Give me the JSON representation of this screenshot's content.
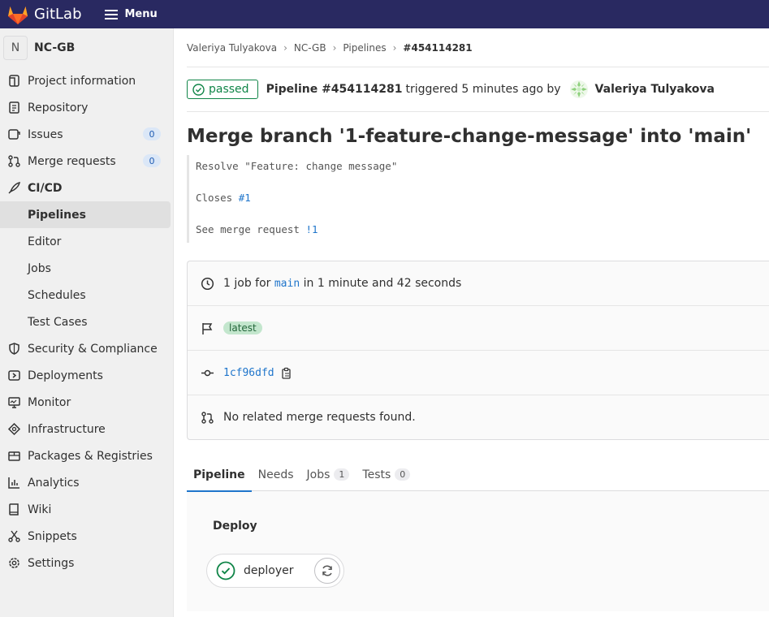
{
  "topbar": {
    "brand": "GitLab",
    "menu_label": "Menu"
  },
  "project": {
    "avatar_letter": "N",
    "name": "NC-GB"
  },
  "sidebar": {
    "items": [
      {
        "label": "Project information",
        "icon": "project-info-icon"
      },
      {
        "label": "Repository",
        "icon": "repository-icon"
      },
      {
        "label": "Issues",
        "icon": "issues-icon",
        "count": "0"
      },
      {
        "label": "Merge requests",
        "icon": "merge-request-icon",
        "count": "0"
      },
      {
        "label": "CI/CD",
        "icon": "rocket-icon"
      },
      {
        "label": "Pipelines"
      },
      {
        "label": "Editor"
      },
      {
        "label": "Jobs"
      },
      {
        "label": "Schedules"
      },
      {
        "label": "Test Cases"
      },
      {
        "label": "Security & Compliance",
        "icon": "shield-icon"
      },
      {
        "label": "Deployments",
        "icon": "deployments-icon"
      },
      {
        "label": "Monitor",
        "icon": "monitor-icon"
      },
      {
        "label": "Infrastructure",
        "icon": "infrastructure-icon"
      },
      {
        "label": "Packages & Registries",
        "icon": "package-icon"
      },
      {
        "label": "Analytics",
        "icon": "analytics-icon"
      },
      {
        "label": "Wiki",
        "icon": "wiki-icon"
      },
      {
        "label": "Snippets",
        "icon": "snippets-icon"
      },
      {
        "label": "Settings",
        "icon": "settings-icon"
      }
    ]
  },
  "breadcrumb": {
    "user": "Valeriya Tulyakova",
    "project": "NC-GB",
    "section": "Pipelines",
    "current": "#454114281"
  },
  "pipeline": {
    "status": "passed",
    "id_label": "Pipeline #454114281",
    "triggered": "triggered 5 minutes ago by",
    "user": "Valeriya Tulyakova",
    "title": "Merge branch '1-feature-change-message' into 'main'",
    "commit_lines": {
      "line1": "Resolve \"Feature: change message\"",
      "line2_prefix": "Closes ",
      "line2_link": "#1",
      "line3_prefix": "See merge request ",
      "line3_link": "!1"
    }
  },
  "info": {
    "jobs_prefix": "1 job for ",
    "branch": "main",
    "jobs_suffix": " in 1 minute and 42 seconds",
    "tag": "latest",
    "sha": "1cf96dfd",
    "merge_requests": "No related merge requests found."
  },
  "tabs": [
    {
      "label": "Pipeline"
    },
    {
      "label": "Needs"
    },
    {
      "label": "Jobs",
      "count": "1"
    },
    {
      "label": "Tests",
      "count": "0"
    }
  ],
  "graph": {
    "stage": "Deploy",
    "job": "deployer"
  },
  "colors": {
    "topbar": "#292961",
    "success": "#108548",
    "link": "#1f75cb"
  }
}
